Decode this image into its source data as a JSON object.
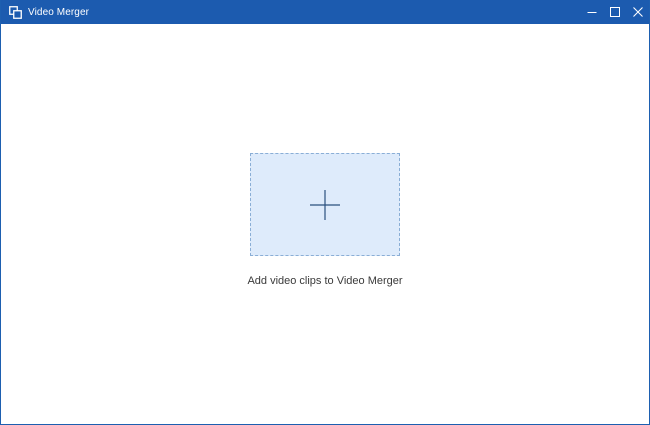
{
  "window": {
    "title": "Video Merger"
  },
  "main": {
    "add_hint": "Add video clips to Video Merger"
  },
  "icons": {
    "app": "overlapping-squares-icon",
    "minimize": "minimize-icon",
    "maximize": "maximize-icon",
    "close": "close-icon",
    "add": "plus-icon"
  },
  "colors": {
    "titlebar": "#1c5baf",
    "dropzone_fill": "#deebfb",
    "dropzone_border": "#8aaed6",
    "plus": "#2a4f7e"
  }
}
